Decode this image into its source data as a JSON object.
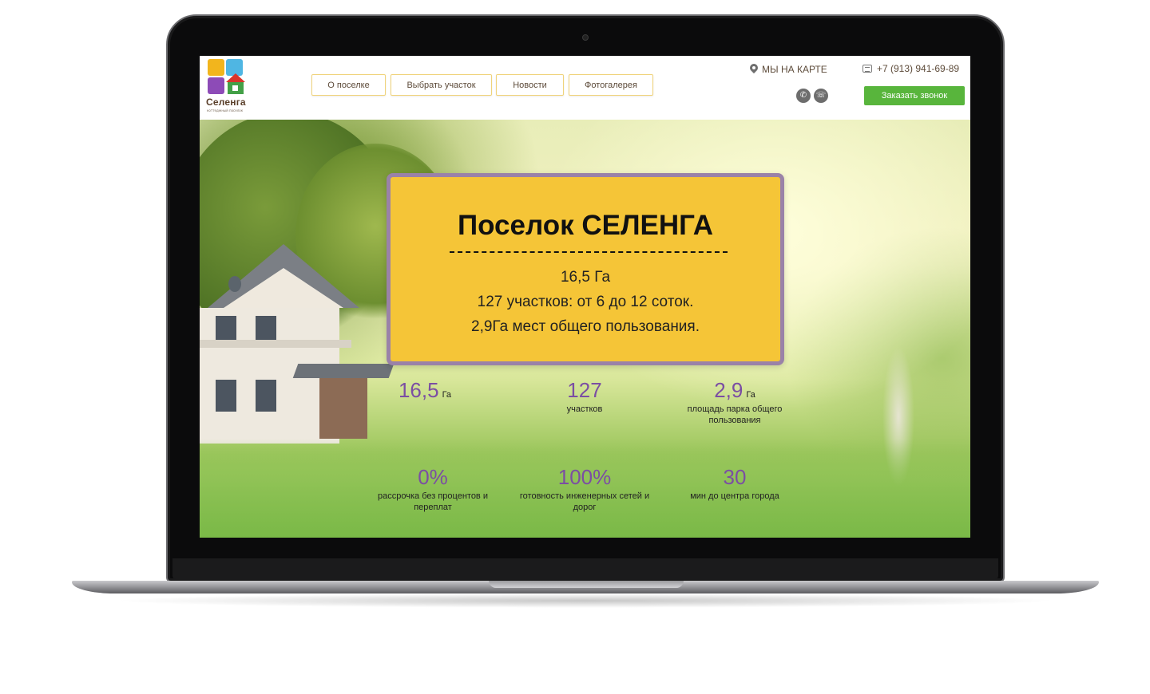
{
  "header": {
    "logo": {
      "name": "Селенга",
      "tagline": "коттеджный поселок"
    },
    "nav": [
      {
        "label": "О поселке"
      },
      {
        "label": "Выбрать участок"
      },
      {
        "label": "Новости"
      },
      {
        "label": "Фотогалерея"
      }
    ],
    "map_link": "МЫ НА КАРТЕ",
    "phone": "+7 (913) 941-69-89",
    "messengers": [
      {
        "icon": "viber-icon",
        "glyph": "✆"
      },
      {
        "icon": "whatsapp-icon",
        "glyph": "☏"
      }
    ],
    "call_button": "Заказать звонок"
  },
  "hero": {
    "title": "Поселок СЕЛЕНГА",
    "lines": [
      "16,5 Га",
      "127 участков: от 6 до 12 соток.",
      "2,9Га мест общего пользования."
    ],
    "stats": [
      {
        "value": "16,5",
        "unit": "Га",
        "label": ""
      },
      {
        "value": "127",
        "unit": "",
        "label": "участков"
      },
      {
        "value": "2,9",
        "unit": "Га",
        "label": "площадь парка общего пользования"
      },
      {
        "value": "0%",
        "unit": "",
        "label": "рассрочка без процентов и переплат"
      },
      {
        "value": "100%",
        "unit": "",
        "label": "готовность инженерных сетей и дорог"
      },
      {
        "value": "30",
        "unit": "",
        "label": "мин до центра города"
      }
    ]
  },
  "colors": {
    "accent_yellow": "#f5c537",
    "accent_purple": "#7b4ea3",
    "button_green": "#58b53c",
    "card_border": "#9a82a8"
  }
}
